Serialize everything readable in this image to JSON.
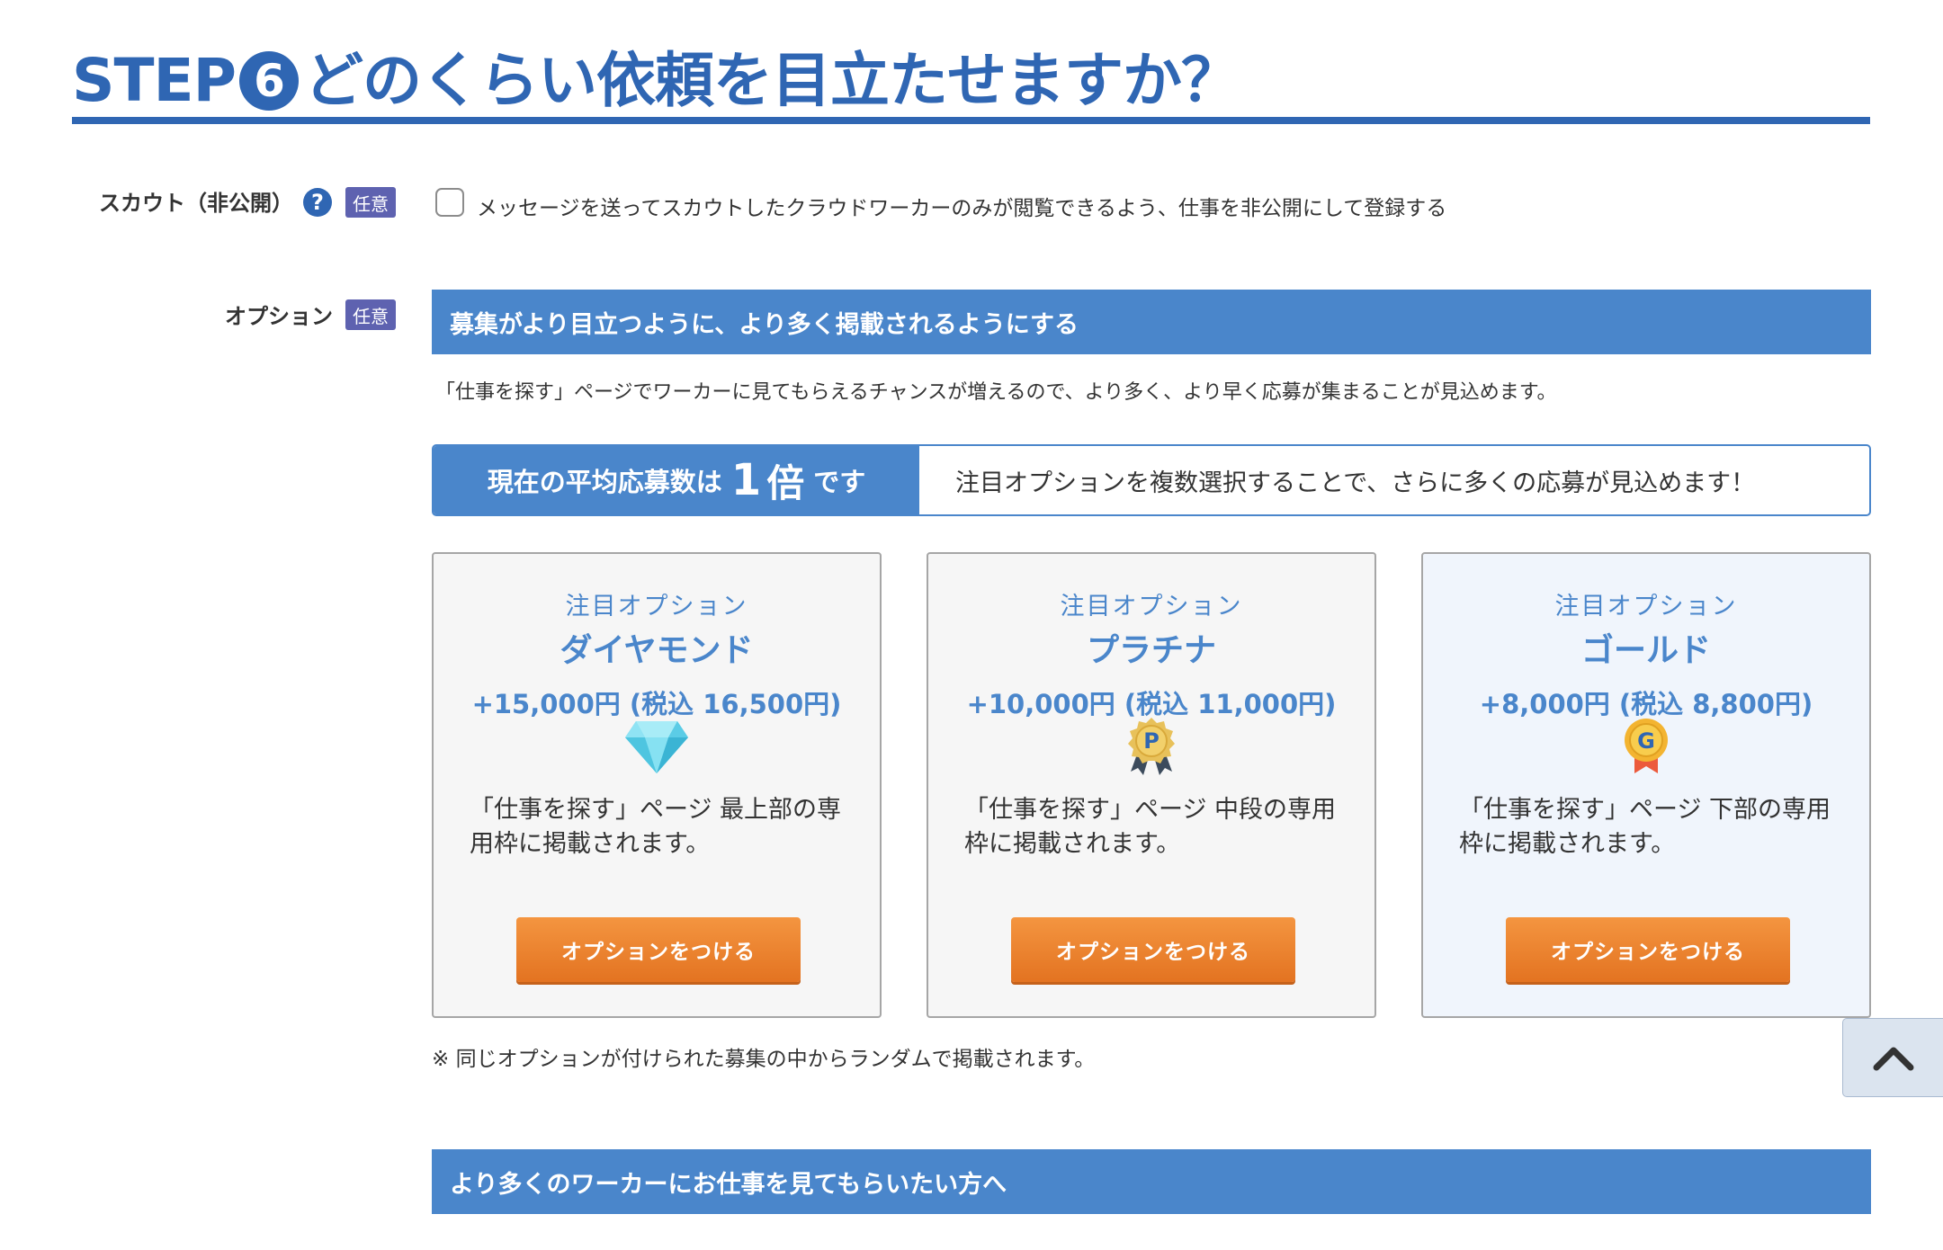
{
  "step": {
    "prefix": "STEP",
    "number": "6",
    "title": "どのくらい依頼を目立たせますか？"
  },
  "scout": {
    "label": "スカウト（非公開）",
    "help_icon": "?",
    "badge": "任意",
    "checked": false,
    "checkbox_text": "メッセージを送ってスカウトしたクラウドワーカーのみが閲覧できるよう、仕事を非公開にして登録する"
  },
  "option": {
    "label": "オプション",
    "badge": "任意",
    "banner": "募集がより目立つように、より多く掲載されるようにする",
    "description": "「仕事を探す」ページでワーカーに見てもらえるチャンスが増えるので、より多く、より早く応募が集まることが見込めます。",
    "average": {
      "prefix": "現在の平均応募数は",
      "value": "1",
      "unit": "倍",
      "suffix": "です",
      "message": "注目オプションを複数選択することで、さらに多くの応募が見込めます！"
    },
    "cards": [
      {
        "subtitle": "注目オプション",
        "name": "ダイヤモンド",
        "price": "+15,000円 (税込 16,500円)",
        "icon": "diamond-icon",
        "description": "「仕事を探す」ページ 最上部の専用枠に掲載されます。",
        "button": "オプションをつける"
      },
      {
        "subtitle": "注目オプション",
        "name": "プラチナ",
        "price": "+10,000円 (税込 11,000円)",
        "icon": "platinum-medal-icon",
        "icon_letter": "P",
        "description": "「仕事を探す」ページ 中段の専用枠に掲載されます。",
        "button": "オプションをつける"
      },
      {
        "subtitle": "注目オプション",
        "name": "ゴールド",
        "price": "+8,000円 (税込 8,800円)",
        "icon": "gold-medal-icon",
        "icon_letter": "G",
        "description": "「仕事を探す」ページ 下部の専用枠に掲載されます。",
        "button": "オプションをつける"
      }
    ],
    "note": "※ 同じオプションが付けられた募集の中からランダムで掲載されます。"
  },
  "more_workers": {
    "banner": "より多くのワーカーにお仕事を見てもらいたい方へ"
  },
  "scroll_top": {
    "icon": "chevron-up-icon"
  },
  "colors": {
    "primary": "#2f66b3",
    "banner": "#4a86cb",
    "badge": "#5e62b0",
    "button": "#e37321",
    "card_bg": "#f6f6f6",
    "card_highlight_bg": "#f0f5fc"
  }
}
